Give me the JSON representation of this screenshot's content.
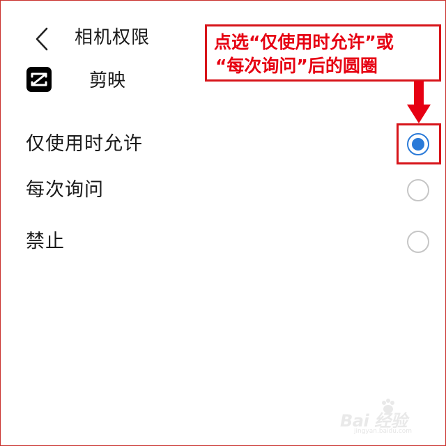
{
  "header": {
    "title": "相机权限"
  },
  "app": {
    "name": "剪映",
    "icon": "capcut-logo-icon"
  },
  "options": [
    {
      "label": "仅使用时允许",
      "selected": true
    },
    {
      "label": "每次询问",
      "selected": false
    },
    {
      "label": "禁止",
      "selected": false
    }
  ],
  "annotation": {
    "line1": "点选“仅使用时允许”或",
    "line2": "“每次询问”后的圆圈",
    "color": "#e60012"
  },
  "watermark": {
    "text": "Bai 经验",
    "sub": "jingyan.baidu.com"
  },
  "colors": {
    "accent": "#2a7ad8",
    "annotation_red": "#d7141a"
  }
}
